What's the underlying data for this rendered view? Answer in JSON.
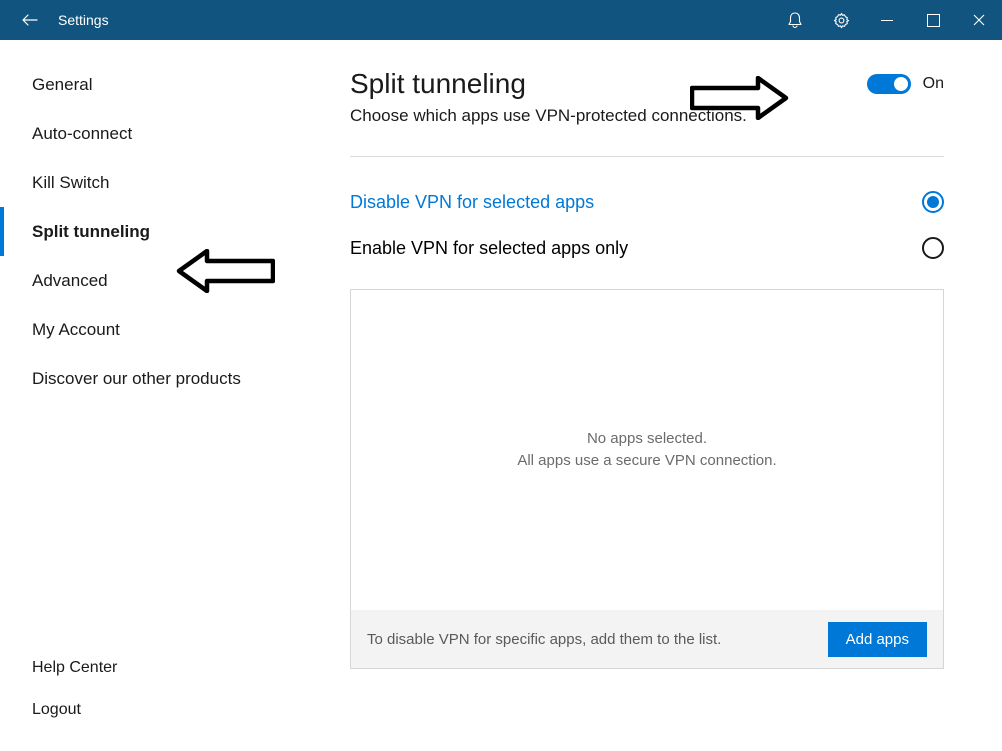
{
  "titlebar": {
    "title": "Settings"
  },
  "sidebar": {
    "items": [
      {
        "label": "General",
        "selected": false
      },
      {
        "label": "Auto-connect",
        "selected": false
      },
      {
        "label": "Kill Switch",
        "selected": false
      },
      {
        "label": "Split tunneling",
        "selected": true
      },
      {
        "label": "Advanced",
        "selected": false
      },
      {
        "label": "My Account",
        "selected": false
      },
      {
        "label": "Discover our other products",
        "selected": false
      }
    ],
    "bottom": [
      {
        "label": "Help Center"
      },
      {
        "label": "Logout"
      }
    ]
  },
  "main": {
    "heading": "Split tunneling",
    "toggle_state": "On",
    "subheading": "Choose which apps use VPN-protected connections.",
    "options": [
      {
        "label": "Disable VPN for selected apps",
        "selected": true
      },
      {
        "label": "Enable VPN for selected apps only",
        "selected": false
      }
    ],
    "apps_box": {
      "empty_line1": "No apps selected.",
      "empty_line2": "All apps use a secure VPN connection.",
      "footer_text": "To disable VPN for specific apps, add them to the list.",
      "add_button": "Add apps"
    }
  }
}
